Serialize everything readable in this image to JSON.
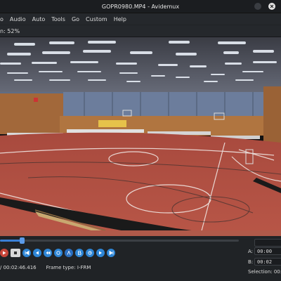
{
  "window": {
    "title": "GOPR0980.MP4 - Avidemux"
  },
  "menu": {
    "items": [
      "o",
      "Audio",
      "Auto",
      "Tools",
      "Go",
      "Custom",
      "Help"
    ]
  },
  "zoom": {
    "label": "n: 52%"
  },
  "playback": {
    "progress": 0.09,
    "buttons": [
      "play",
      "stop",
      "prev-keyframe",
      "prev-frame",
      "rewind",
      "back-one-minute",
      "set-marker-a",
      "set-marker-b",
      "forward-one-minute",
      "next-frame",
      "next-keyframe"
    ]
  },
  "status": {
    "time": "/ 00:02:46.416",
    "frame_type": "Frame type:  I-FRM"
  },
  "selection": {
    "a_label": "A:",
    "a_value": "00:00",
    "b_label": "B:",
    "b_value": "00:02",
    "selection_label": "Selection: 00:0"
  },
  "colors": {
    "accent": "#2e86d6",
    "floor": "#b54a3d"
  }
}
